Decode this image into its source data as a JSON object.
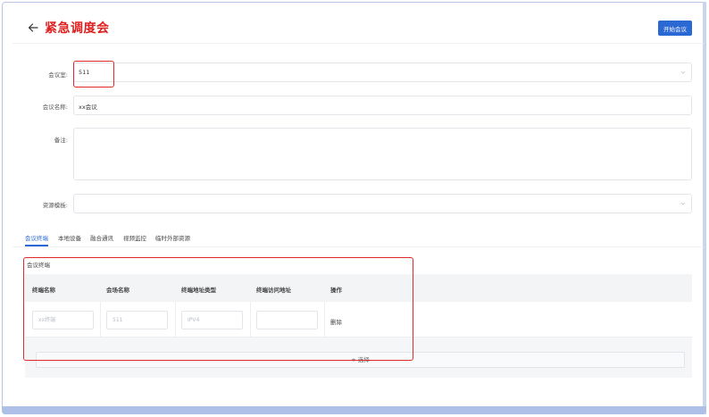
{
  "header": {
    "title": "紧急调度会",
    "start_button": "开始会议"
  },
  "form": {
    "room": {
      "label": "会议室:",
      "value": "511"
    },
    "name": {
      "label": "会议名称:",
      "value": "xx会议"
    },
    "remark": {
      "label": "备注:",
      "value": ""
    },
    "template": {
      "label": "资源模板:",
      "value": ""
    }
  },
  "tabs": [
    "会议终端",
    "本地设备",
    "融合通讯",
    "视频监控",
    "临时外部资源"
  ],
  "active_tab": "会议终端",
  "section": {
    "title": "会议终端",
    "columns": [
      "终端名称",
      "会场名称",
      "终端地址类型",
      "终端访问地址",
      "操作"
    ],
    "rows": [
      {
        "terminal_name": "xx终端",
        "venue_name": "511",
        "address_type": "IPV4",
        "access_address": "",
        "action": "删除"
      }
    ],
    "add_label": "+ 选择"
  },
  "colors": {
    "accent": "#2a68d4",
    "title_red": "#e02020",
    "highlight_box": "#e02a2a"
  },
  "icons": {
    "back": "arrow-left-icon",
    "select": "chevron-down-icon"
  }
}
